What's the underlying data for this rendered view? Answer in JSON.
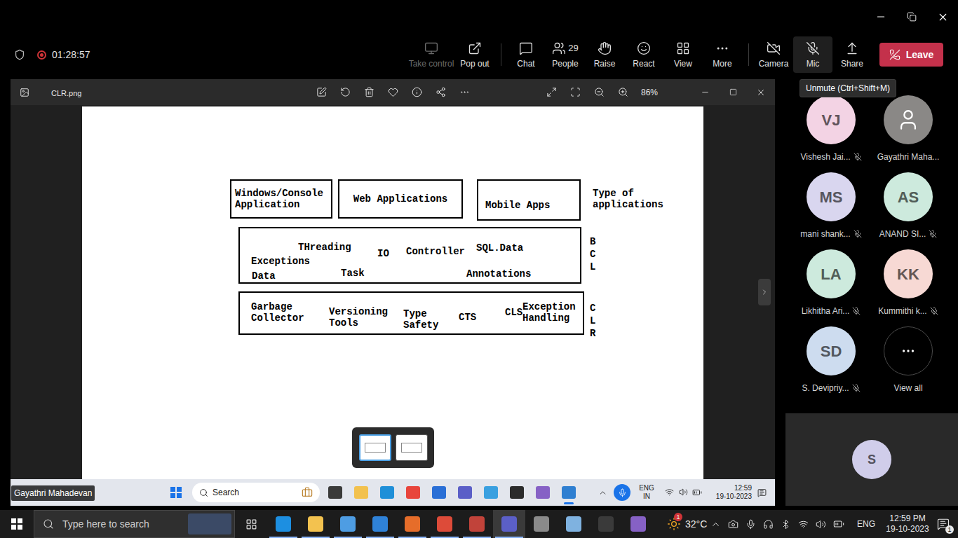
{
  "meeting": {
    "timer": "01:28:57",
    "recording": true,
    "toolbar": [
      {
        "label": "Take control",
        "disabled": true
      },
      {
        "label": "Pop out",
        "disabled": false
      }
    ],
    "controls": [
      {
        "label": "Chat"
      },
      {
        "label": "People",
        "badge": "29"
      },
      {
        "label": "Raise"
      },
      {
        "label": "React"
      },
      {
        "label": "View"
      },
      {
        "label": "More"
      }
    ],
    "camera": {
      "label": "Camera",
      "off": true
    },
    "mic": {
      "label": "Mic",
      "muted": true
    },
    "share": {
      "label": "Share"
    },
    "leave": "Leave",
    "tooltip": "Unmute (Ctrl+Shift+M)"
  },
  "viewer": {
    "filename": "CLR.png",
    "zoom": "86%",
    "thumbnails": [
      {
        "selected": true
      },
      {
        "selected": false
      }
    ]
  },
  "diagram": {
    "app_types": [
      "Windows/Console Application",
      "Web Applications",
      "Mobile Apps"
    ],
    "app_label": "Type of applications",
    "bcl": {
      "label": "BCL",
      "items": [
        "THreading",
        "IO",
        "Controller",
        "SQL.Data",
        "Exceptions",
        "Task",
        "Annotations",
        "Data"
      ]
    },
    "clr": {
      "label": "CLR",
      "items": [
        "Garbage Collector",
        "Versioning Tools",
        "Type Safety",
        "CTS",
        "CLS",
        "Exception Handling"
      ]
    }
  },
  "presenter": "Gayathri Mahadevan",
  "remote_taskbar": {
    "search": "Search",
    "lang": "ENG",
    "region": "IN",
    "time": "12:59",
    "date": "19-10-2023"
  },
  "participants": [
    {
      "initials": "VJ",
      "name": "Vishesh Jai...",
      "muted": true,
      "color": "#f3d3e4"
    },
    {
      "initials": "",
      "name": "Gayathri Maha...",
      "muted": false,
      "color": "#8a8886"
    },
    {
      "initials": "MS",
      "name": "mani shank...",
      "muted": true,
      "color": "#d9d6ef"
    },
    {
      "initials": "AS",
      "name": "ANAND SI...",
      "muted": true,
      "color": "#cdeadd"
    },
    {
      "initials": "LA",
      "name": "Likhitha Ari...",
      "muted": true,
      "color": "#cdeadd"
    },
    {
      "initials": "KK",
      "name": "Kummithi k...",
      "muted": true,
      "color": "#f7d9d4"
    },
    {
      "initials": "SD",
      "name": "S. Devipriy...",
      "muted": true,
      "color": "#cddcef"
    }
  ],
  "view_all": "View all",
  "spotlight": {
    "initials": "S",
    "color": "#d0cdea"
  },
  "taskbar": {
    "search": "Type here to search",
    "weather": "32°C",
    "weather_badge": "1",
    "lang": "ENG",
    "time": "12:59 PM",
    "date": "19-10-2023",
    "notifications": "1"
  }
}
